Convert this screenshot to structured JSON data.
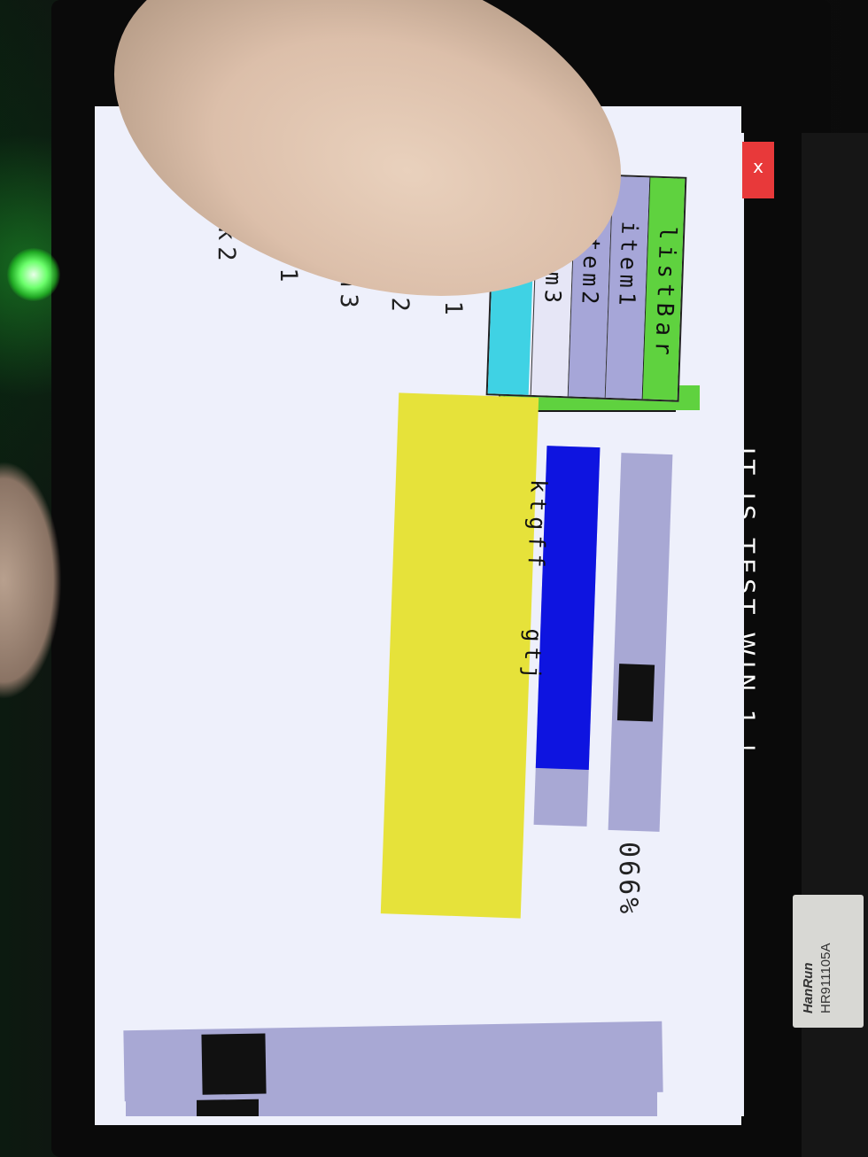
{
  "window": {
    "title": "IT IS TEST WIN 1 !",
    "close_label": "x"
  },
  "listbox": {
    "header": "listBar",
    "items": [
      "item1",
      "item2",
      "item3",
      ""
    ]
  },
  "radios": [
    "option1",
    "option2",
    "option3"
  ],
  "checks": [
    "check1",
    "check2"
  ],
  "slider": {
    "value_label": "066%",
    "value": 0.66
  },
  "progress": {
    "value": 0.85
  },
  "textarea": {
    "line1": "ktgff   gtj"
  },
  "hscroll": {
    "value": 0.12
  },
  "device": {
    "chip_brand": "HanRun",
    "chip_model": "HR911105A"
  },
  "colors": {
    "screen_bg": "#eef0fb",
    "listbox_header": "#5fd23f",
    "progress_fill": "#0e14e0",
    "textarea_bg": "#e6e23a",
    "close_bg": "#e8393a"
  }
}
